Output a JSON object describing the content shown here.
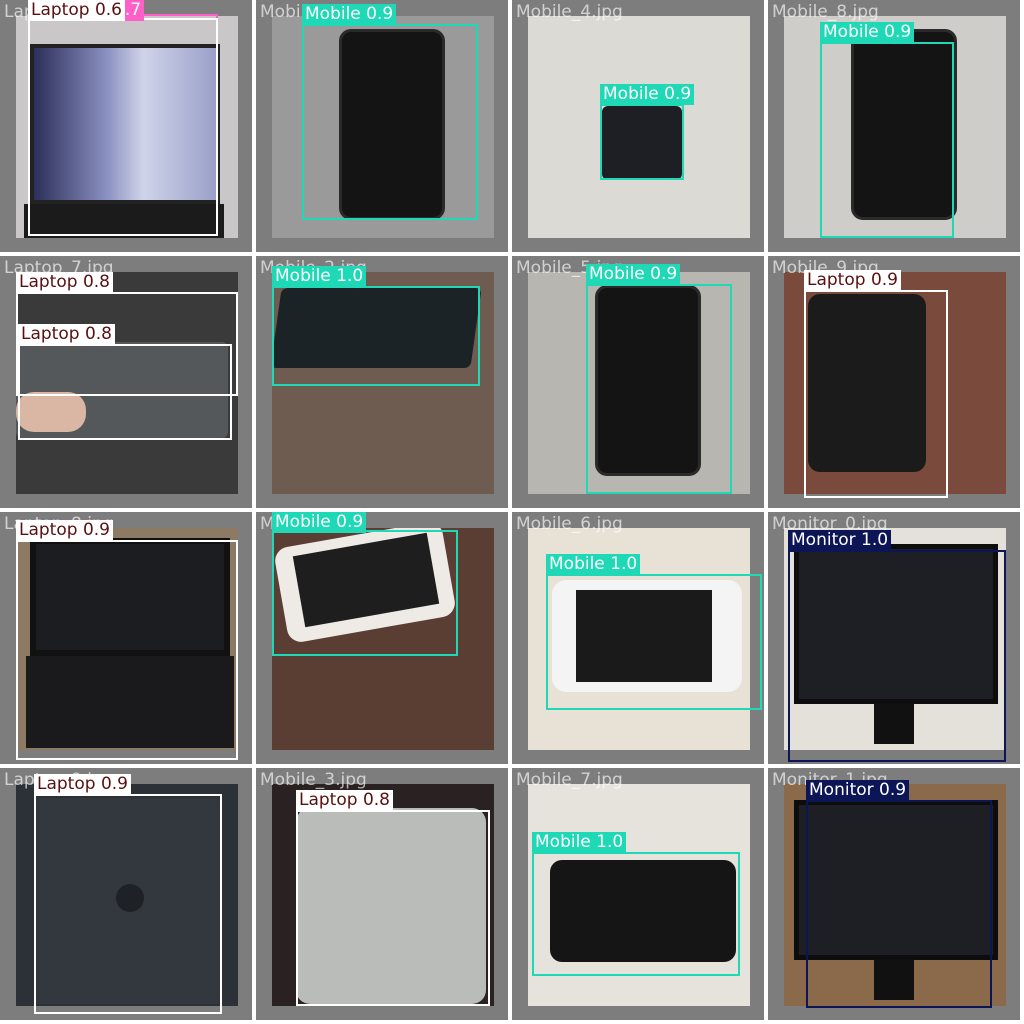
{
  "colors": {
    "Mobile": "#1fd8b5",
    "Laptop": "#ffffff",
    "Monitor": "#0c1657",
    "Category": "#ff5fc8"
  },
  "tiles": [
    {
      "filename": "Laptop_6.jpg",
      "bg": "#c9c7c8",
      "scene": "laptop-broken",
      "detections": [
        {
          "cls": "Category",
          "text": "Category 0.7"
        },
        {
          "cls": "Laptop",
          "text": "Laptop 0.6"
        }
      ]
    },
    {
      "filename": "Mobile_1.jpg",
      "bg": "#9a9a9a",
      "scene": "phone-front",
      "detections": [
        {
          "cls": "Mobile",
          "text": "Mobile 0.9"
        }
      ]
    },
    {
      "filename": "Mobile_4.jpg",
      "bg": "#dcdad5",
      "scene": "phone-small",
      "detections": [
        {
          "cls": "Mobile",
          "text": "Mobile 0.9"
        }
      ]
    },
    {
      "filename": "Mobile_8.jpg",
      "bg": "#cfcdc9",
      "scene": "phone-front",
      "detections": [
        {
          "cls": "Mobile",
          "text": "Mobile 0.9"
        }
      ]
    },
    {
      "filename": "Laptop_7.jpg",
      "bg": "#3a3a3a",
      "scene": "laptop-bottom",
      "detections": [
        {
          "cls": "Laptop",
          "text": "Laptop 0.8"
        },
        {
          "cls": "Laptop",
          "text": "Laptop 0.8"
        }
      ]
    },
    {
      "filename": "Mobile_2.jpg",
      "bg": "#6e5c50",
      "scene": "phone-flat",
      "detections": [
        {
          "cls": "Mobile",
          "text": "Mobile 1.0"
        }
      ]
    },
    {
      "filename": "Mobile_5.jpg",
      "bg": "#b8b6b1",
      "scene": "phone-front",
      "detections": [
        {
          "cls": "Mobile",
          "text": "Mobile 0.9"
        }
      ]
    },
    {
      "filename": "Mobile_9.jpg",
      "bg": "#7a4a3c",
      "scene": "phone-back",
      "detections": [
        {
          "cls": "Laptop",
          "text": "Laptop 0.9"
        }
      ]
    },
    {
      "filename": "Laptop_8.jpg",
      "bg": "#8d7a64",
      "scene": "laptop-open",
      "detections": [
        {
          "cls": "Laptop",
          "text": "Laptop 0.9"
        }
      ]
    },
    {
      "filename": "Mobile_3.jpg",
      "bg": "#5a3d33",
      "scene": "phone-white",
      "detections": [
        {
          "cls": "Mobile",
          "text": "Mobile 0.9"
        }
      ]
    },
    {
      "filename": "Mobile_6.jpg",
      "bg": "#e8e2d6",
      "scene": "phone-white-flat",
      "detections": [
        {
          "cls": "Mobile",
          "text": "Mobile 1.0"
        }
      ]
    },
    {
      "filename": "Monitor_0.jpg",
      "bg": "#e4e0da",
      "scene": "monitor",
      "detections": [
        {
          "cls": "Monitor",
          "text": "Monitor 1.0"
        }
      ]
    },
    {
      "filename": "Laptop_9.jpg",
      "bg": "#2c3138",
      "scene": "laptop-lid",
      "detections": [
        {
          "cls": "Laptop",
          "text": "Laptop 0.9"
        }
      ]
    },
    {
      "filename": "Mobile_3.jpg",
      "bg": "#2a2222",
      "scene": "phone-silver-back",
      "detections": [
        {
          "cls": "Laptop",
          "text": "Laptop 0.8"
        }
      ]
    },
    {
      "filename": "Mobile_7.jpg",
      "bg": "#e6e3dc",
      "scene": "phone-flat-dark",
      "detections": [
        {
          "cls": "Mobile",
          "text": "Mobile 1.0"
        }
      ]
    },
    {
      "filename": "Monitor_1.jpg",
      "bg": "#8b6a4c",
      "scene": "monitor",
      "detections": [
        {
          "cls": "Monitor",
          "text": "Monitor 0.9"
        }
      ]
    }
  ]
}
